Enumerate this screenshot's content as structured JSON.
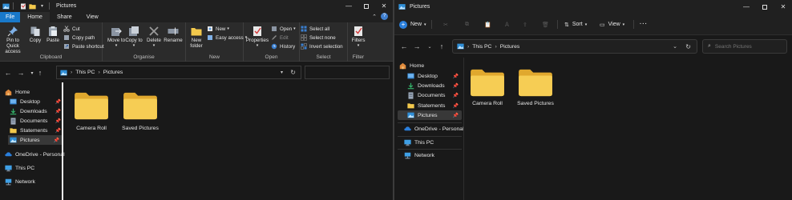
{
  "left_window": {
    "title": "Pictures",
    "tabs": {
      "file": "File",
      "home": "Home",
      "share": "Share",
      "view": "View"
    },
    "ribbon": {
      "clipboard": {
        "label": "Clipboard",
        "pin_to_quick_access": "Pin to Quick access",
        "copy": "Copy",
        "paste": "Paste",
        "cut": "Cut",
        "copy_path": "Copy path",
        "paste_shortcut": "Paste shortcut"
      },
      "organise": {
        "label": "Organise",
        "move_to": "Move to",
        "copy_to": "Copy to",
        "delete": "Delete",
        "rename": "Rename"
      },
      "new": {
        "label": "New",
        "new_folder": "New folder",
        "new_item": "New",
        "easy_access": "Easy access"
      },
      "open": {
        "label": "Open",
        "properties": "Properties",
        "open": "Open",
        "edit": "Edit",
        "history": "History"
      },
      "select": {
        "label": "Select",
        "select_all": "Select all",
        "select_none": "Select none",
        "invert_selection": "Invert selection"
      },
      "filters": {
        "label": "Filter",
        "filters": "Filters"
      }
    },
    "breadcrumb": [
      "This PC",
      "Pictures"
    ],
    "nav": {
      "home": "Home",
      "desktop": "Desktop",
      "downloads": "Downloads",
      "documents": "Documents",
      "statements": "Statements",
      "pictures": "Pictures",
      "onedrive": "OneDrive - Personal",
      "this_pc": "This PC",
      "network": "Network"
    },
    "folders": [
      "Camera Roll",
      "Saved Pictures"
    ]
  },
  "right_window": {
    "title": "Pictures",
    "toolbar": {
      "new": "New",
      "sort": "Sort",
      "view": "View",
      "more": "···"
    },
    "breadcrumb": [
      "This PC",
      "Pictures"
    ],
    "search_placeholder": "Search Pictures",
    "nav": {
      "home": "Home",
      "desktop": "Desktop",
      "downloads": "Downloads",
      "documents": "Documents",
      "statements": "Statements",
      "pictures": "Pictures",
      "onedrive": "OneDrive - Personal",
      "this_pc": "This PC",
      "network": "Network"
    },
    "folders": [
      "Camera Roll",
      "Saved Pictures"
    ]
  },
  "colors": {
    "accent": "#1979ca",
    "folder_yellow": "#f3c94c",
    "folder_dark": "#e0a82e",
    "background": "#191919"
  }
}
